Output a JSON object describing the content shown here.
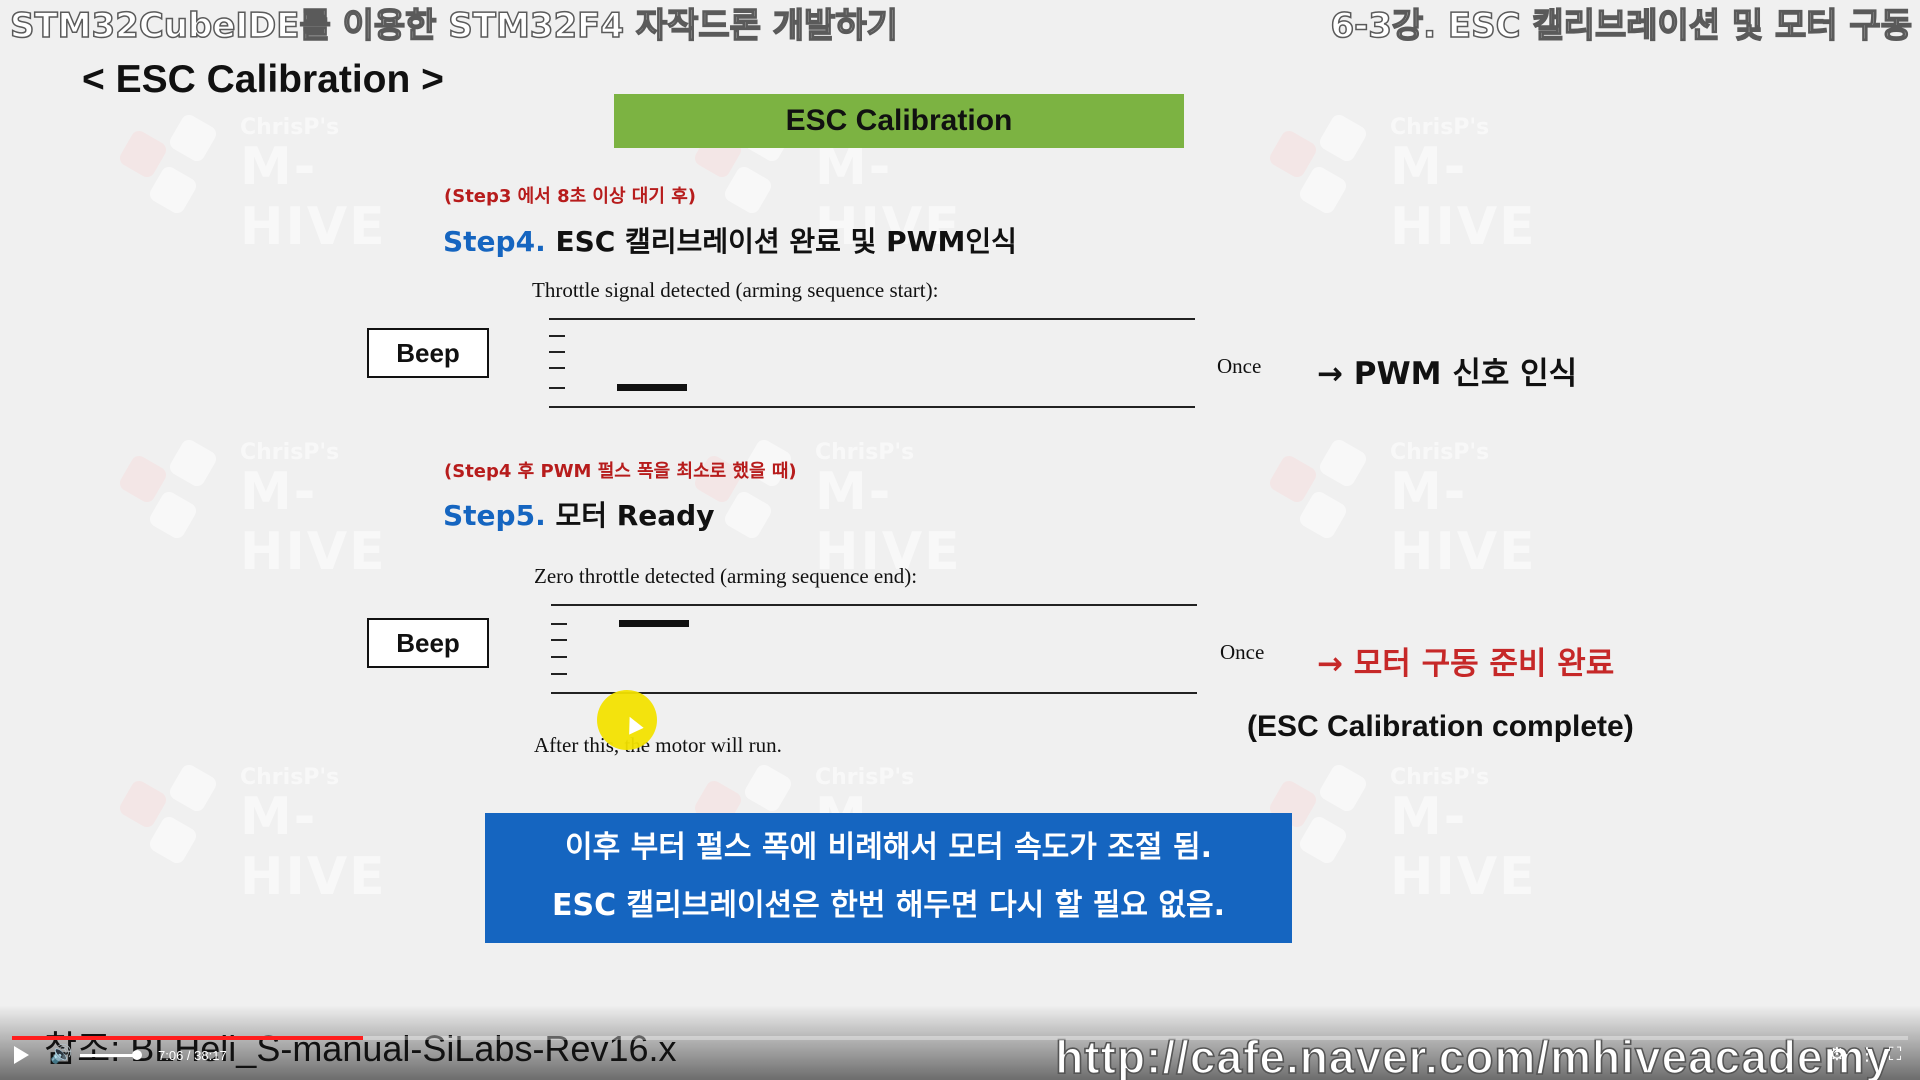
{
  "header": {
    "left_title": "STM32CubeIDE를 이용한 STM32F4 자작드론 개발하기",
    "right_title": "6-3강. ESC 캘리브레이션 및 모터 구동"
  },
  "slide": {
    "section_title": "< ESC Calibration >",
    "banner": "ESC Calibration",
    "step4": {
      "note": "(Step3 에서 8초 이상 대기 후)",
      "label_num": "Step4.",
      "label_text": " ESC 캘리브레이션 완료 및 PWM인식",
      "caption": "Throttle signal detected (arming sequence start):",
      "beep": "Beep",
      "once": "Once",
      "result": "→ PWM 신호 인식"
    },
    "step5": {
      "note": "(Step4 후 PWM 펄스 폭을 최소로 했을 때)",
      "label_num": "Step5.",
      "label_text": " 모터 Ready",
      "caption": "Zero throttle detected (arming sequence end):",
      "beep": "Beep",
      "once": "Once",
      "result": "→ 모터 구동 준비 완료",
      "after": "After this, the motor will run.",
      "complete": "(ESC Calibration complete)"
    },
    "info_box": {
      "line1": "이후 부터 펄스 폭에 비례해서 모터 속도가 조절 됨.",
      "line2": "ESC 캘리브레이션은 한번 해두면 다시 할 필요 없음."
    },
    "reference": "참조: BLHeli_S-manual-SiLabs-Rev16.x",
    "url": "http://cafe.naver.com/mhiveacademy",
    "watermark": {
      "small": "ChrisP's",
      "big": "M-HIVE"
    }
  },
  "player": {
    "time": "7:06 / 38:17",
    "progress": 0.185,
    "volume": 1.0,
    "colors": {
      "progress": "#ff1e1e"
    }
  }
}
